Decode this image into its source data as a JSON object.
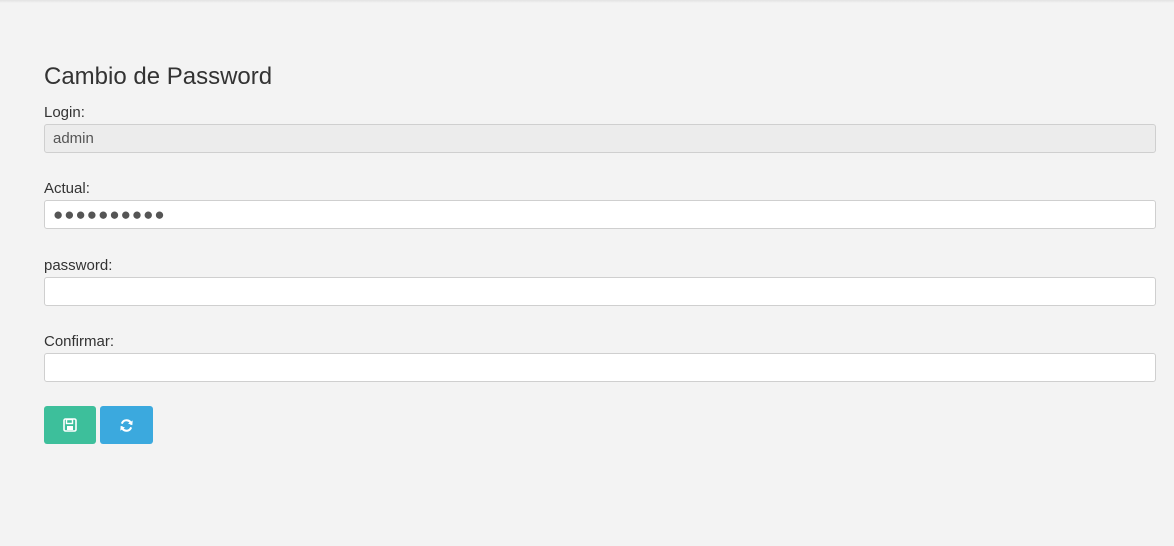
{
  "form": {
    "title": "Cambio de Password",
    "login": {
      "label": "Login:",
      "value": "admin"
    },
    "actual": {
      "label": "Actual:",
      "value": "●●●●●●●●●●"
    },
    "password": {
      "label": "password:",
      "value": ""
    },
    "confirmar": {
      "label": "Confirmar:",
      "value": ""
    },
    "buttons": {
      "save_icon": "save-icon",
      "refresh_icon": "refresh-icon"
    }
  },
  "colors": {
    "background": "#f3f3f3",
    "save_button": "#3dbf9b",
    "refresh_button": "#3ba9de",
    "readonly_input": "#ececec"
  }
}
